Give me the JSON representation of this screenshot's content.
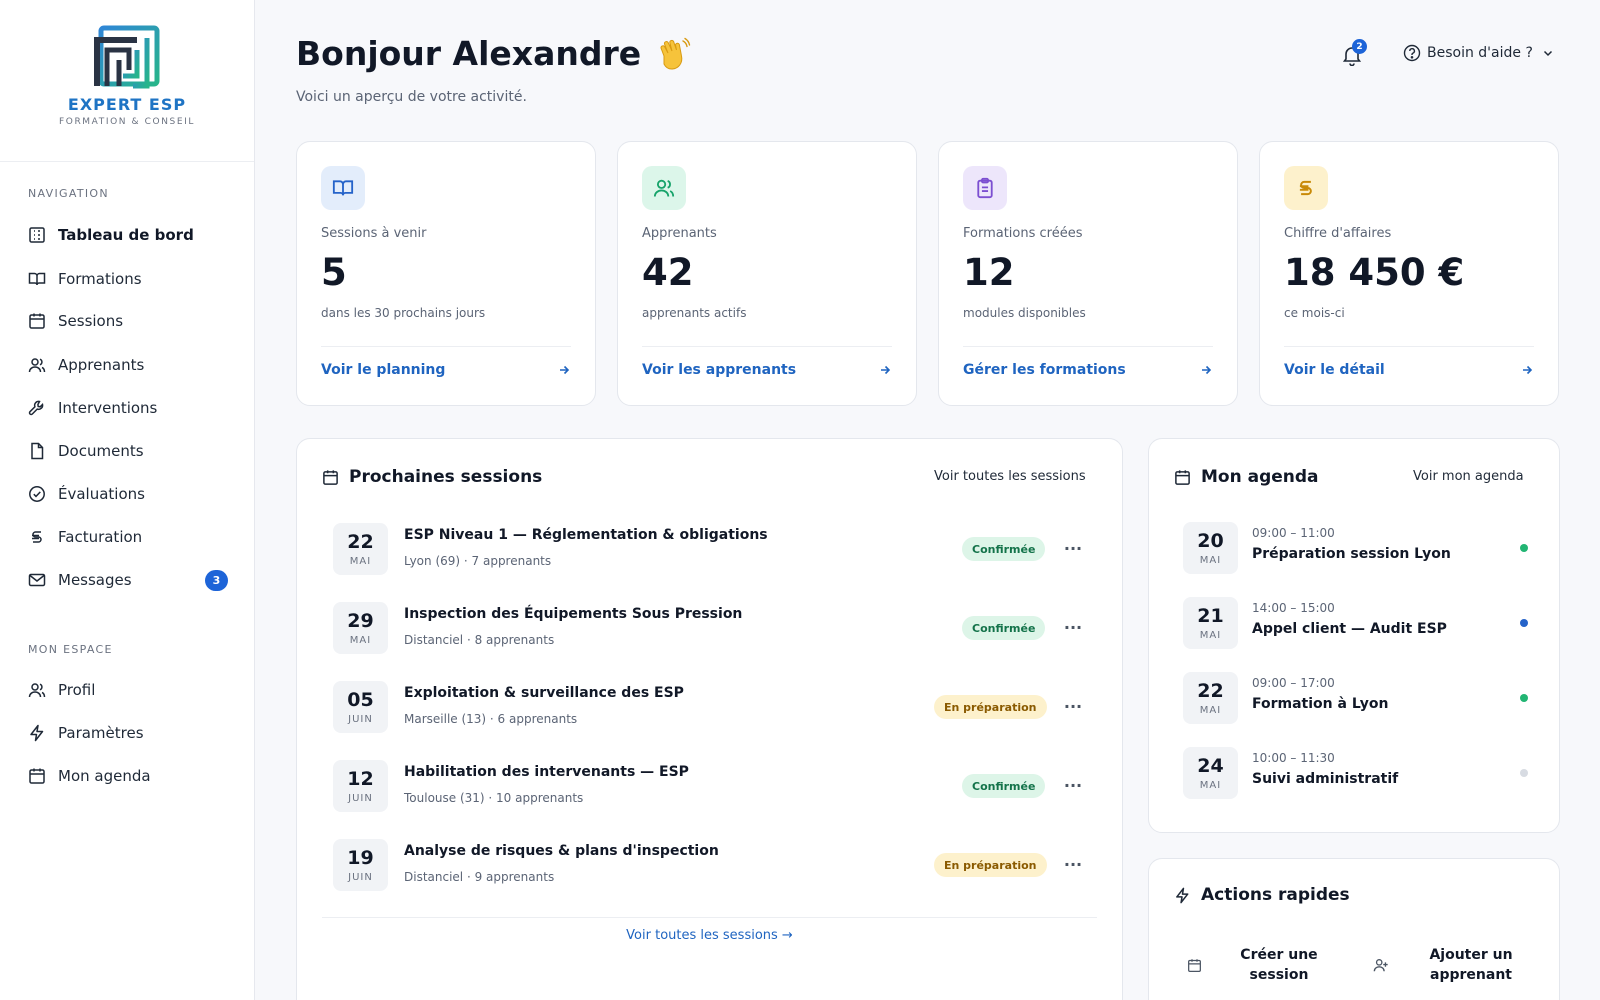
{
  "brand": {
    "name": "EXPERT ESP",
    "tagline": "FORMATION & CONSEIL"
  },
  "sidebar": {
    "section_nav": "NAVIGATION",
    "nav": [
      {
        "label": "Tableau de bord",
        "icon": "dashboard-icon",
        "active": true
      },
      {
        "label": "Formations",
        "icon": "book-icon"
      },
      {
        "label": "Sessions",
        "icon": "calendar-icon"
      },
      {
        "label": "Apprenants",
        "icon": "users-icon"
      },
      {
        "label": "Interventions",
        "icon": "wrench-icon"
      },
      {
        "label": "Documents",
        "icon": "document-icon"
      },
      {
        "label": "Évaluations",
        "icon": "check-circle-icon"
      },
      {
        "label": "Facturation",
        "icon": "currency-icon"
      },
      {
        "label": "Messages",
        "icon": "mail-icon",
        "badge": "3"
      }
    ],
    "section_space": "MON ESPACE",
    "space": [
      {
        "label": "Profil",
        "icon": "user-icon"
      },
      {
        "label": "Paramètres",
        "icon": "bolt-icon"
      },
      {
        "label": "Mon agenda",
        "icon": "calendar-icon"
      }
    ]
  },
  "header": {
    "greeting": "Bonjour Alexandre",
    "subtitle": "Voici un aperçu de votre activité.",
    "notifications": "2",
    "help_label": "Besoin d'aide ?"
  },
  "kpis": [
    {
      "label": "Sessions à venir",
      "value": "5",
      "sub": "dans les 30 prochains jours",
      "link": "Voir le planning",
      "icon": "book-icon",
      "icon_bg": "#e3edfb",
      "icon_color": "#2563c9"
    },
    {
      "label": "Apprenants",
      "value": "42",
      "sub": "apprenants actifs",
      "link": "Voir les apprenants",
      "icon": "users-icon",
      "icon_bg": "#dcf6ea",
      "icon_color": "#16a36a"
    },
    {
      "label": "Formations créées",
      "value": "12",
      "sub": "modules disponibles",
      "link": "Gérer les formations",
      "icon": "clipboard-icon",
      "icon_bg": "#ede6fb",
      "icon_color": "#7c4fd1"
    },
    {
      "label": "Chiffre d'affaires",
      "value": "18 450 €",
      "sub": "ce mois-ci",
      "link": "Voir le détail",
      "icon": "currency-icon",
      "icon_bg": "#fdf1cc",
      "icon_color": "#c98a07"
    }
  ],
  "sessions": {
    "title": "Prochaines sessions",
    "link": "Voir toutes les sessions",
    "footer_link": "Voir toutes les sessions →",
    "rows": [
      {
        "day": "22",
        "month": "MAI",
        "title": "ESP Niveau 1 — Réglementation & obligations",
        "meta": "Lyon (69) · 7 apprenants",
        "status": "Confirmée",
        "kind": "ok"
      },
      {
        "day": "29",
        "month": "MAI",
        "title": "Inspection des Équipements Sous Pression",
        "meta": "Distanciel · 8 apprenants",
        "status": "Confirmée",
        "kind": "ok"
      },
      {
        "day": "05",
        "month": "JUIN",
        "title": "Exploitation & surveillance des ESP",
        "meta": "Marseille (13) · 6 apprenants",
        "status": "En préparation",
        "kind": "prep"
      },
      {
        "day": "12",
        "month": "JUIN",
        "title": "Habilitation des intervenants — ESP",
        "meta": "Toulouse (31) · 10 apprenants",
        "status": "Confirmée",
        "kind": "ok"
      },
      {
        "day": "19",
        "month": "JUIN",
        "title": "Analyse de risques & plans d'inspection",
        "meta": "Distanciel · 9 apprenants",
        "status": "En préparation",
        "kind": "prep"
      }
    ]
  },
  "agenda": {
    "title": "Mon agenda",
    "link": "Voir mon agenda",
    "rows": [
      {
        "day": "20",
        "month": "MAI",
        "time": "09:00 – 11:00",
        "title": "Préparation session Lyon",
        "dot": "#22b573"
      },
      {
        "day": "21",
        "month": "MAI",
        "time": "14:00 – 15:00",
        "title": "Appel client — Audit ESP",
        "dot": "#2563c9"
      },
      {
        "day": "22",
        "month": "MAI",
        "time": "09:00 – 17:00",
        "title": "Formation à Lyon",
        "dot": "#22b573"
      },
      {
        "day": "24",
        "month": "MAI",
        "time": "10:00 – 11:30",
        "title": "Suivi administratif",
        "dot": "#d7dbe2"
      }
    ]
  },
  "quick": {
    "title": "Actions rapides",
    "create_session": "Créer une session",
    "add_learner": "Ajouter un apprenant"
  }
}
